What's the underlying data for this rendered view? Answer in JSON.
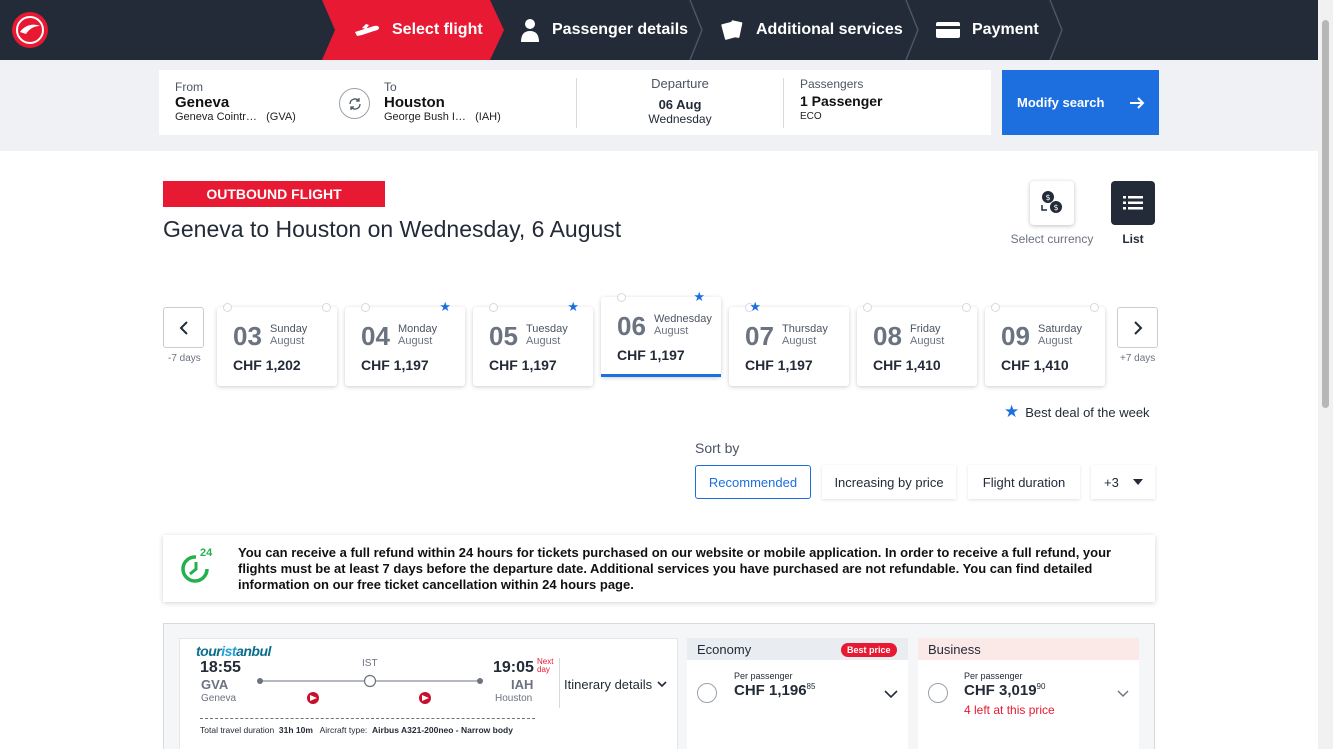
{
  "steps": [
    {
      "label": "Select flight",
      "icon": "plane-icon"
    },
    {
      "label": "Passenger details",
      "icon": "person-icon"
    },
    {
      "label": "Additional services",
      "icon": "tickets-icon"
    },
    {
      "label": "Payment",
      "icon": "card-icon"
    }
  ],
  "search": {
    "from_label": "From",
    "from_city": "Geneva",
    "from_airport": "Geneva Cointr…",
    "from_code": "(GVA)",
    "to_label": "To",
    "to_city": "Houston",
    "to_airport": "George Bush I…",
    "to_code": "(IAH)",
    "departure_label": "Departure",
    "departure_date": "06 Aug",
    "departure_day": "Wednesday",
    "passengers_label": "Passengers",
    "passengers_value": "1 Passenger",
    "cabin": "ECO",
    "modify_label": "Modify search"
  },
  "header": {
    "badge": "OUTBOUND FLIGHT",
    "title": "Geneva to Houston on Wednesday, 6 August",
    "currency_label": "Select currency",
    "list_label": "List"
  },
  "dates": {
    "prev_label": "-7 days",
    "next_label": "+7 days",
    "days": [
      {
        "num": "03",
        "weekday": "Sunday",
        "month": "August",
        "price": "CHF 1,202",
        "best": false,
        "selected": false
      },
      {
        "num": "04",
        "weekday": "Monday",
        "month": "August",
        "price": "CHF 1,197",
        "best": true,
        "selected": false
      },
      {
        "num": "05",
        "weekday": "Tuesday",
        "month": "August",
        "price": "CHF 1,197",
        "best": true,
        "selected": false
      },
      {
        "num": "06",
        "weekday": "Wednesday",
        "month": "August",
        "price": "CHF 1,197",
        "best": true,
        "selected": true
      },
      {
        "num": "07",
        "weekday": "Thursday",
        "month": "August",
        "price": "CHF 1,197",
        "best": true,
        "selected": false
      },
      {
        "num": "08",
        "weekday": "Friday",
        "month": "August",
        "price": "CHF 1,410",
        "best": false,
        "selected": false
      },
      {
        "num": "09",
        "weekday": "Saturday",
        "month": "August",
        "price": "CHF 1,410",
        "best": false,
        "selected": false
      }
    ],
    "best_deal_label": "Best deal of the week"
  },
  "sort": {
    "label": "Sort by",
    "options": [
      "Recommended",
      "Increasing by price",
      "Flight duration"
    ],
    "more": "+3"
  },
  "info": {
    "icon_text": "24",
    "text": "You can receive a full refund within 24 hours for tickets purchased on our website or mobile application. In order to receive a full refund, your flights must be at least 7 days before the departure date. Additional services you have purchased are not refundable. You can find detailed information on our free ticket cancellation within 24 hours page."
  },
  "flight": {
    "brand_a": "tour",
    "brand_b": "ist",
    "brand_c": "anbul",
    "dep_time": "18:55",
    "dep_code": "GVA",
    "dep_city": "Geneva",
    "stop": "IST",
    "arr_time": "19:05",
    "arr_next": "Next day",
    "arr_code": "IAH",
    "arr_city": "Houston",
    "itinerary_label": "Itinerary details",
    "duration_label": "Total travel duration",
    "duration": "31h 10m",
    "aircraft_label": "Aircraft type:",
    "aircraft": "Airbus A321-200neo - Narrow body",
    "economy": {
      "label": "Economy",
      "badge": "Best price",
      "per": "Per passenger",
      "price": "CHF 1,196",
      "cents": "85"
    },
    "business": {
      "label": "Business",
      "per": "Per passenger",
      "price": "CHF 3,019",
      "cents": "90",
      "left": "4 left at this price"
    }
  },
  "colors": {
    "brand_red": "#e81932",
    "accent_blue": "#1d6fe0",
    "navy": "#232b38"
  }
}
